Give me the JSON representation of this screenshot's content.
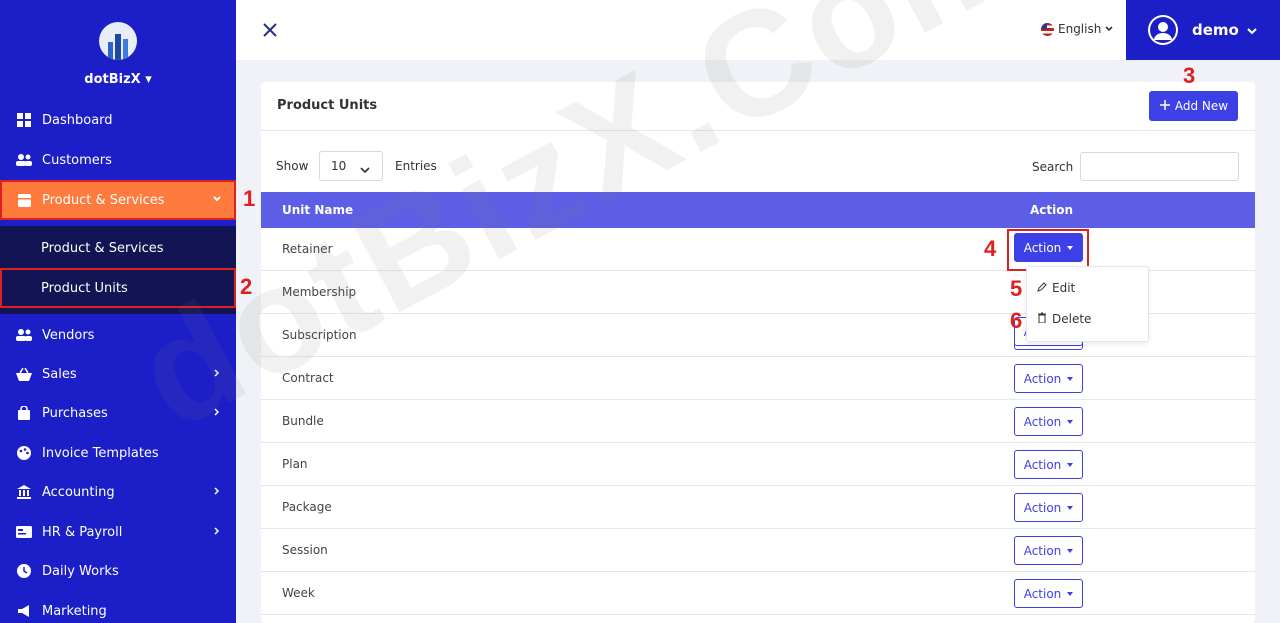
{
  "brand": {
    "name": "dotBizX"
  },
  "sidebar": {
    "items": [
      {
        "label": "Dashboard",
        "icon": "grid-icon"
      },
      {
        "label": "Customers",
        "icon": "users-icon"
      },
      {
        "label": "Product & Services",
        "icon": "box-icon",
        "active": true
      },
      {
        "label": "Vendors",
        "icon": "users-icon"
      },
      {
        "label": "Sales",
        "icon": "basket-icon"
      },
      {
        "label": "Purchases",
        "icon": "bag-icon"
      },
      {
        "label": "Invoice Templates",
        "icon": "palette-icon"
      },
      {
        "label": "Accounting",
        "icon": "bank-icon"
      },
      {
        "label": "HR & Payroll",
        "icon": "id-card-icon"
      },
      {
        "label": "Daily Works",
        "icon": "clock-icon"
      },
      {
        "label": "Marketing",
        "icon": "megaphone-icon"
      }
    ],
    "submenu": [
      {
        "label": "Product & Services"
      },
      {
        "label": "Product Units",
        "selected": true
      }
    ]
  },
  "topbar": {
    "language": "English",
    "user": "demo"
  },
  "card": {
    "title": "Product Units",
    "add_label": "Add New",
    "show_label": "Show",
    "page_size": "10",
    "entries_label": "Entries",
    "search_label": "Search",
    "search_value": "",
    "columns": [
      "Unit Name",
      "Action"
    ],
    "rows": [
      {
        "name": "Retainer"
      },
      {
        "name": "Membership"
      },
      {
        "name": "Subscription"
      },
      {
        "name": "Contract"
      },
      {
        "name": "Bundle"
      },
      {
        "name": "Plan"
      },
      {
        "name": "Package"
      },
      {
        "name": "Session"
      },
      {
        "name": "Week"
      }
    ],
    "action_label": "Action",
    "dropdown": {
      "edit": "Edit",
      "delete": "Delete"
    }
  },
  "annotations": [
    "1",
    "2",
    "3",
    "4",
    "5",
    "6"
  ],
  "watermark": "dotBizX.Com",
  "colors": {
    "primary": "#1c1fc7",
    "accent": "#ff7a3d",
    "button": "#3c40e6",
    "table_header": "#5c5fe6",
    "annotation": "#e02020"
  }
}
